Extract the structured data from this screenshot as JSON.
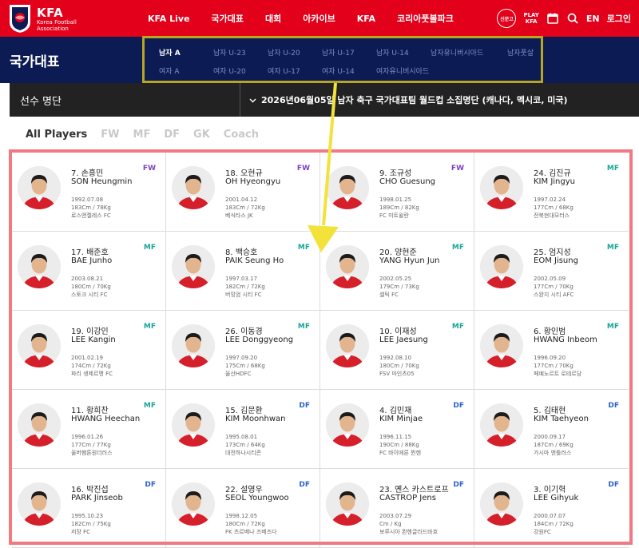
{
  "topnav": {
    "brand": "KFA",
    "brand_sub": "Korea Football Association",
    "menu": [
      "KFA Live",
      "국가대표",
      "대회",
      "아카이브",
      "KFA",
      "코리아풋볼파크"
    ],
    "badge": "신문고",
    "play_kfa": [
      "PLAY",
      "KFA"
    ],
    "lang": "EN",
    "login": "로그인",
    "colors": {
      "bar": "#e2001a"
    }
  },
  "section": {
    "title": "국가대표",
    "submenu_row1": [
      "남자 A",
      "남자 U-23",
      "남자 U-20",
      "남자 U-17",
      "남자 U-14",
      "남자유니버시아드",
      "남자풋살"
    ],
    "submenu_row2": [
      "여자 A",
      "여자 U-20",
      "여자 U-17",
      "여자 U-14",
      "여자유니버시아드"
    ],
    "active": "남자 A",
    "colors": {
      "bar": "#0c1b53",
      "highlight_box": "#b8a520"
    }
  },
  "roster": {
    "label": "선수 명단",
    "selected": "2026년06월05일 남자 축구 국가대표팀 월드컵 소집명단 (캐나다, 멕시코, 미국)"
  },
  "filters": [
    "All Players",
    "FW",
    "MF",
    "DF",
    "GK",
    "Coach"
  ],
  "active_filter": "All Players",
  "position_colors": {
    "FW": "#7b3fbf",
    "MF": "#1aa59a",
    "DF": "#2a63c9"
  },
  "players": [
    {
      "name_kr": "7. 손흥민",
      "name_en": "SON Heungmin",
      "birth": "1992.07.08",
      "body": "183Cm / 78Kg",
      "club": "로스앤젤레스 FC",
      "pos": "FW"
    },
    {
      "name_kr": "18. 오현규",
      "name_en": "OH Hyeongyu",
      "birth": "2001.04.12",
      "body": "183Cm / 72Kg",
      "club": "베식타스 JK",
      "pos": "FW"
    },
    {
      "name_kr": "9. 조규성",
      "name_en": "CHO Guesung",
      "birth": "1998.01.25",
      "body": "189Cm / 82Kg",
      "club": "FC 미트윌란",
      "pos": "FW"
    },
    {
      "name_kr": "24. 김진규",
      "name_en": "KIM Jingyu",
      "birth": "1997.02.24",
      "body": "177Cm / 68Kg",
      "club": "전북현대모터스",
      "pos": "MF"
    },
    {
      "name_kr": "17. 배준호",
      "name_en": "BAE Junho",
      "birth": "2003.08.21",
      "body": "180Cm / 70Kg",
      "club": "스토크 시티 FC",
      "pos": "MF"
    },
    {
      "name_kr": "8. 백승호",
      "name_en": "PAIK Seung Ho",
      "birth": "1997.03.17",
      "body": "182Cm / 72Kg",
      "club": "버밍엄 시티 FC",
      "pos": "MF"
    },
    {
      "name_kr": "20. 양현준",
      "name_en": "YANG Hyun Jun",
      "birth": "2002.05.25",
      "body": "179Cm / 73Kg",
      "club": "셀틱 FC",
      "pos": "MF"
    },
    {
      "name_kr": "25. 엄지성",
      "name_en": "EOM Jisung",
      "birth": "2002.05.09",
      "body": "177Cm / 70Kg",
      "club": "스완지 시티 AFC",
      "pos": "MF"
    },
    {
      "name_kr": "19. 이강인",
      "name_en": "LEE Kangin",
      "birth": "2001.02.19",
      "body": "174Cm / 72Kg",
      "club": "파리 생제르맹 FC",
      "pos": "MF"
    },
    {
      "name_kr": "26. 이동경",
      "name_en": "LEE Donggyeong",
      "birth": "1997.09.20",
      "body": "175Cm / 68Kg",
      "club": "울산HDFC",
      "pos": "MF"
    },
    {
      "name_kr": "10. 이재성",
      "name_en": "LEE Jaesung",
      "birth": "1992.08.10",
      "body": "180Cm / 70Kg",
      "club": "FSV 마인츠05",
      "pos": "MF"
    },
    {
      "name_kr": "6. 황인범",
      "name_en": "HWANG Inbeom",
      "birth": "1996.09.20",
      "body": "177Cm / 70Kg",
      "club": "페예노르트 로테르담",
      "pos": "MF"
    },
    {
      "name_kr": "11. 황희찬",
      "name_en": "HWANG Heechan",
      "birth": "1996.01.26",
      "body": "177Cm / 77Kg",
      "club": "울버햄튼원더러스",
      "pos": "MF"
    },
    {
      "name_kr": "15. 김문환",
      "name_en": "KIM Moonhwan",
      "birth": "1995.08.01",
      "body": "173Cm / 64Kg",
      "club": "대전하나시티즌",
      "pos": "DF"
    },
    {
      "name_kr": "4. 김민재",
      "name_en": "KIM Minjae",
      "birth": "1996.11.15",
      "body": "190Cm / 88Kg",
      "club": "FC 바이에른 뮌헨",
      "pos": "DF"
    },
    {
      "name_kr": "5. 김태현",
      "name_en": "KIM Taehyeon",
      "birth": "2000.09.17",
      "body": "187Cm / 69Kg",
      "club": "가시마 앤틀러스",
      "pos": "DF"
    },
    {
      "name_kr": "16. 박진섭",
      "name_en": "PARK Jinseob",
      "birth": "1995.10.23",
      "body": "182Cm / 75Kg",
      "club": "저장 FC",
      "pos": "DF"
    },
    {
      "name_kr": "22. 설영우",
      "name_en": "SEOL Youngwoo",
      "birth": "1998.12.05",
      "body": "180Cm / 72Kg",
      "club": "FK 츠르베나 즈베즈다",
      "pos": "DF"
    },
    {
      "name_kr": "23. 옌스 카스트로프",
      "name_en": "CASTROP Jens",
      "birth": "2003.07.29",
      "body": "Cm / Kg",
      "club": "보루시아 묀헨글라드바흐",
      "pos": "DF"
    },
    {
      "name_kr": "3. 이기혁",
      "name_en": "LEE Gihyuk",
      "birth": "2000.07.07",
      "body": "184Cm / 72Kg",
      "club": "강원FC",
      "pos": "DF"
    }
  ]
}
